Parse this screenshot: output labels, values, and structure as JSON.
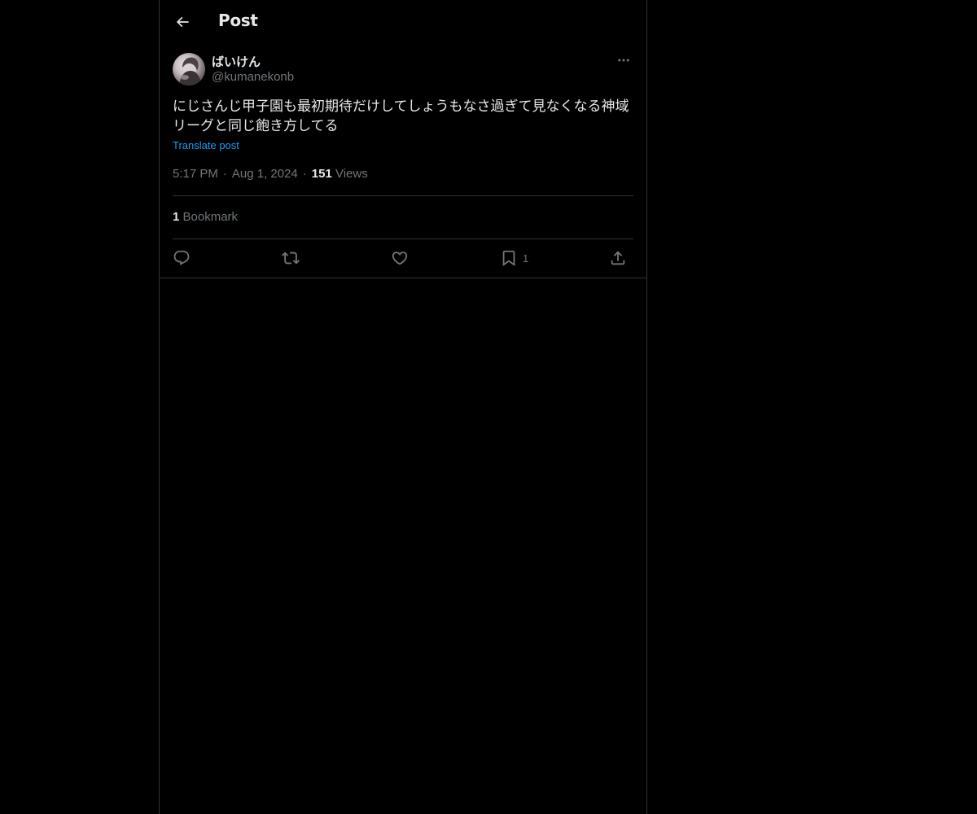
{
  "header": {
    "title": "Post",
    "back_icon": "arrow-left-icon"
  },
  "post": {
    "author": {
      "display_name": "ばいけん",
      "handle": "@kumanekonb",
      "avatar_icon": "avatar-photo"
    },
    "more_icon": "ellipsis-icon",
    "text": "にじさんじ甲子園も最初期待だけしてしょうもなさ過ぎて見なくなる神域リーグと同じ飽き方してる",
    "translate_label": "Translate post",
    "time": "5:17 PM",
    "date": "Aug 1, 2024",
    "separator": "·",
    "views_count": "151",
    "views_label": "Views"
  },
  "stats": {
    "bookmark_count": "1",
    "bookmark_label": "Bookmark"
  },
  "actions": {
    "reply_icon": "reply-icon",
    "repost_icon": "repost-icon",
    "like_icon": "heart-icon",
    "bookmark_icon": "bookmark-icon",
    "bookmark_count": "1",
    "share_icon": "share-icon"
  },
  "colors": {
    "background": "#000000",
    "text_primary": "#e7e9ea",
    "text_secondary": "#71767b",
    "link": "#1d9bf0",
    "border": "#2f3336"
  }
}
